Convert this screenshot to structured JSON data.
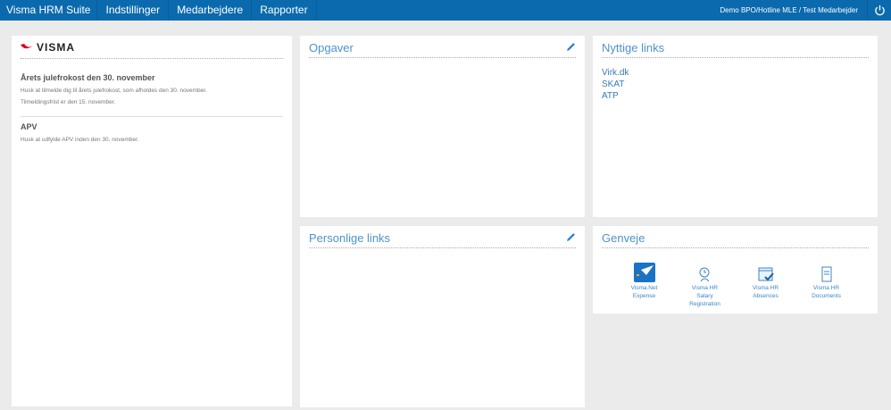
{
  "nav": {
    "brand": "Visma HRM Suite",
    "items": [
      "Indstillinger",
      "Medarbejdere",
      "Rapporter"
    ],
    "user": "Demo BPO/Hotline MLE / Test Medarbejder"
  },
  "news": {
    "logo": "VISMA",
    "items": [
      {
        "title": "Årets julefrokost den 30. november",
        "lines": [
          "Husk at tilmelde dig til årets julefrokost, som afholdes den 30. november.",
          "Tilmeldingsfrist er den 15. november."
        ]
      },
      {
        "title": "APV",
        "lines": [
          "Husk at udfylde APV inden den 30. november."
        ]
      }
    ]
  },
  "tasks": {
    "title": "Opgaver"
  },
  "personal": {
    "title": "Personlige links"
  },
  "useful": {
    "title": "Nyttige links",
    "links": [
      "Virk.dk",
      "SKAT",
      "ATP"
    ]
  },
  "shortcuts": {
    "title": "Genveje",
    "items": [
      {
        "l1": "Visma.Net",
        "l2": "Expense",
        "l3": ""
      },
      {
        "l1": "Visma HR",
        "l2": "Salary",
        "l3": "Registration"
      },
      {
        "l1": "Visma HR",
        "l2": "Absences",
        "l3": ""
      },
      {
        "l1": "Visma HR",
        "l2": "Documents",
        "l3": ""
      }
    ]
  }
}
